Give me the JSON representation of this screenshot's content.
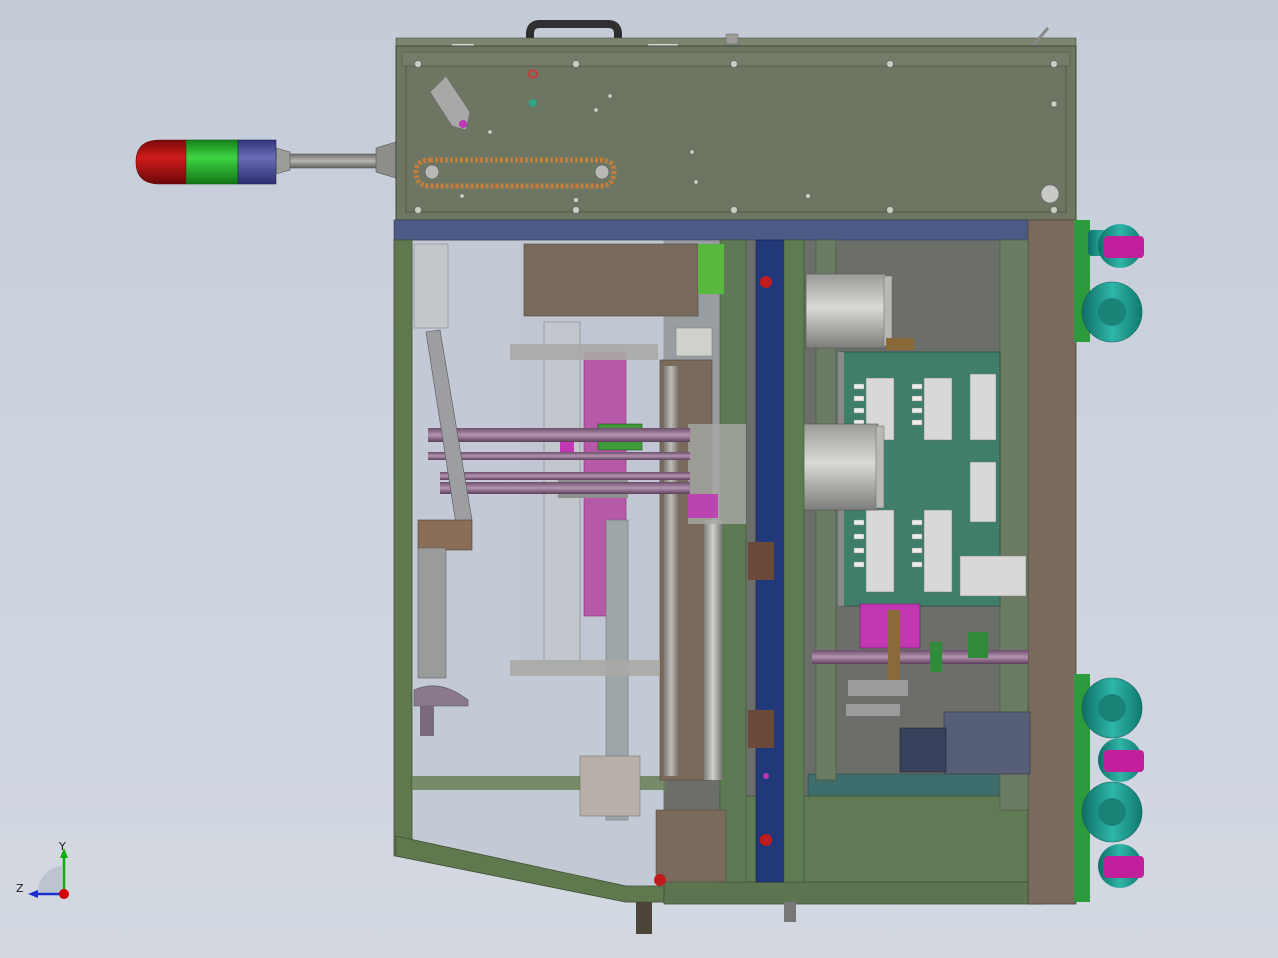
{
  "view": {
    "triad": {
      "y_label": "Y",
      "z_label": "Z",
      "x_color": "#d40000",
      "y_color": "#11aa11",
      "z_color": "#1a2fcf"
    }
  },
  "colors": {
    "background": "#c8d0db",
    "housing": "#6c7660",
    "frame": "#5f7b54",
    "panel_back": "#6a6a68",
    "pcb": "#3f7e6b",
    "caster": "#1f9a8e",
    "caster_hub": "#c21f9c",
    "bus_bar": "#21397a",
    "stack_light_red": "#b80f0f",
    "stack_light_green": "#27b52a",
    "stack_light_blue": "#4c4f94"
  },
  "components": {
    "stack_light": [
      "red",
      "green",
      "blue"
    ],
    "casters_count": 6,
    "view_icon": "axis-triad-icon"
  }
}
